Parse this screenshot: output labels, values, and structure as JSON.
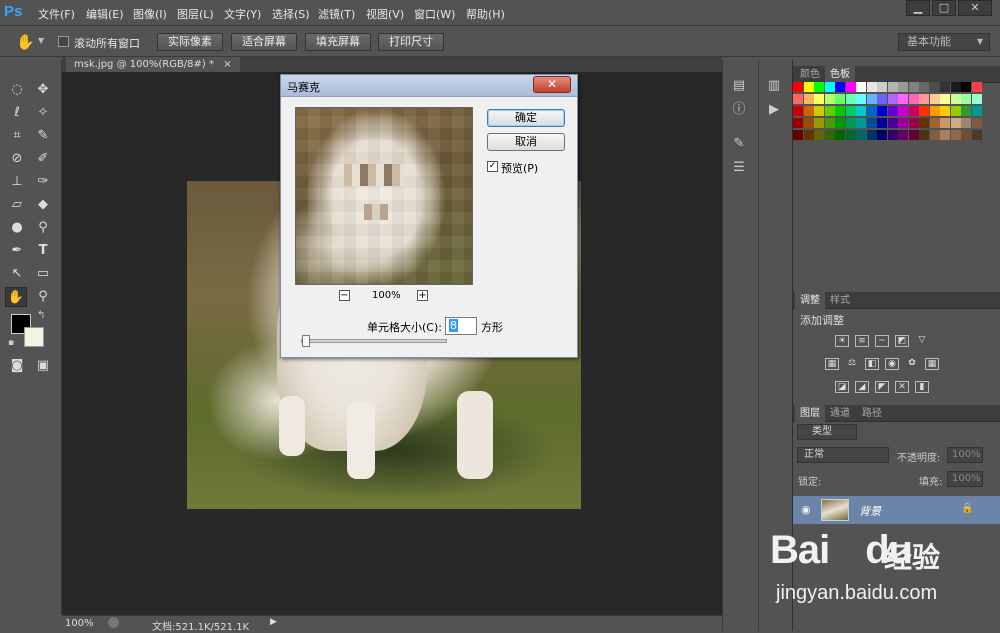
{
  "app": {
    "logo": "Ps"
  },
  "menu": [
    "文件(F)",
    "编辑(E)",
    "图像(I)",
    "图层(L)",
    "文字(Y)",
    "选择(S)",
    "滤镜(T)",
    "视图(V)",
    "窗口(W)",
    "帮助(H)"
  ],
  "window_buttons": [
    "▁",
    "□",
    "✕"
  ],
  "options": {
    "scroll_all_label": "滚动所有窗口",
    "buttons": [
      "实际像素",
      "适合屏幕",
      "填充屏幕",
      "打印尺寸"
    ],
    "workspace": "基本功能"
  },
  "document": {
    "tab": "msk.jpg @ 100%(RGB/8#) *",
    "tab_close": "×"
  },
  "status": {
    "zoom": "100%",
    "doc_info": "文档:521.1K/521.1K"
  },
  "dialog": {
    "title": "马赛克",
    "close": "✕",
    "ok": "确定",
    "cancel": "取消",
    "preview_label": "预览(P)",
    "preview_checked": true,
    "zoom": "100%",
    "zoom_minus": "−",
    "zoom_plus": "+",
    "cell_size_label": "单元格大小(C):",
    "cell_size_value": "8",
    "cell_unit": "方形",
    "slider_fraction": 0.02
  },
  "panels": {
    "color_tabs": [
      "颜色",
      "色板"
    ],
    "adjust_tabs": [
      "调整",
      "样式"
    ],
    "adjust_title": "添加调整",
    "layer_tabs": [
      "图层",
      "通道",
      "路径"
    ],
    "kind_filter": "类型",
    "blend_mode": "正常",
    "opacity_label": "不透明度:",
    "opacity_value": "100%",
    "lock_label": "锁定:",
    "fill_label": "填充:",
    "fill_value": "100%",
    "layer_name": "背景"
  },
  "watermark": {
    "brand": "Bai",
    "brand2": "du",
    "brand_cn": "经验",
    "url": "jingyan.baidu.com"
  },
  "colors": {
    "accent": "#31a8ff",
    "selected_layer": "#6b84a8",
    "dialog_title": "#b4c6de"
  }
}
